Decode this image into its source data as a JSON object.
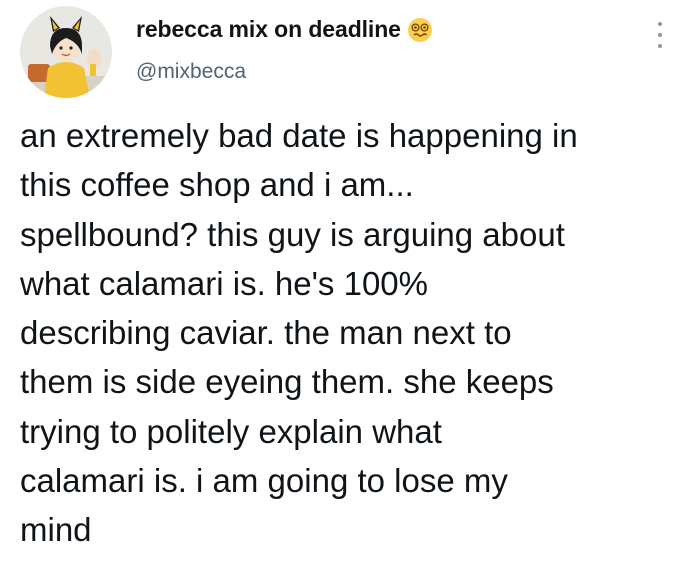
{
  "author": {
    "display_name": "rebecca mix on deadline",
    "handle": "@mixbecca",
    "name_emoji": "dizzy-face-emoji",
    "avatar": "profile-avatar-illustration"
  },
  "menu": {
    "icon": "more-vertical-icon"
  },
  "tweet": {
    "lines": [
      "an extremely bad date is happening in",
      "this coffee shop and i am...",
      "spellbound? this guy is arguing about",
      "what calamari is. he's 100%",
      "describing caviar. the man next to",
      "them is side eyeing them. she keeps",
      "trying to politely explain what",
      "calamari is. i am going to lose my",
      "mind"
    ]
  },
  "colors": {
    "text": "#0f1419",
    "secondary_text": "#536471",
    "background": "#ffffff",
    "avatar_yellow": "#f2c233"
  }
}
